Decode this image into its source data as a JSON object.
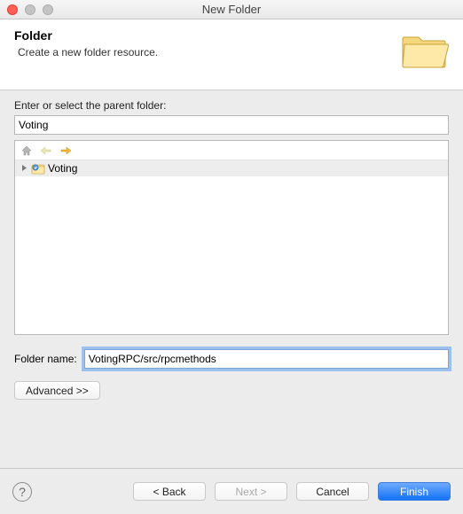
{
  "window": {
    "title": "New Folder"
  },
  "header": {
    "heading": "Folder",
    "description": "Create a new folder resource."
  },
  "parent": {
    "label": "Enter or select the parent folder:",
    "value": "Voting",
    "tree": {
      "items": [
        {
          "label": "Voting"
        }
      ]
    }
  },
  "folderName": {
    "label": "Folder name:",
    "value": "VotingRPC/src/rpcmethods"
  },
  "advanced": {
    "label": "Advanced >>"
  },
  "buttons": {
    "back": "< Back",
    "next": "Next >",
    "cancel": "Cancel",
    "finish": "Finish"
  }
}
